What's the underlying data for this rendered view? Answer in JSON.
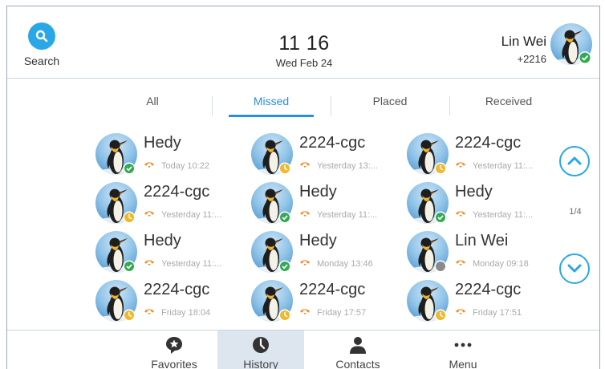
{
  "header": {
    "search_label": "Search",
    "time": "11 16",
    "date": "Wed Feb 24",
    "user_name": "Lin Wei",
    "user_ext": "+2216",
    "user_status_color": "#34a853"
  },
  "tabs": [
    {
      "label": "All",
      "active": false
    },
    {
      "label": "Missed",
      "active": true
    },
    {
      "label": "Placed",
      "active": false
    },
    {
      "label": "Received",
      "active": false
    }
  ],
  "history": [
    {
      "name": "Hedy",
      "time": "Today 10:22",
      "status": "online"
    },
    {
      "name": "2224-cgc",
      "time": "Yesterday 13:...",
      "status": "away"
    },
    {
      "name": "2224-cgc",
      "time": "Yesterday 11:...",
      "status": "away"
    },
    {
      "name": "2224-cgc",
      "time": "Yesterday 11:...",
      "status": "away"
    },
    {
      "name": "Hedy",
      "time": "Yesterday 11:...",
      "status": "online"
    },
    {
      "name": "Hedy",
      "time": "Yesterday 11:...",
      "status": "online"
    },
    {
      "name": "Hedy",
      "time": "Yesterday 11:...",
      "status": "online"
    },
    {
      "name": "Hedy",
      "time": "Monday 13:46",
      "status": "online"
    },
    {
      "name": "Lin Wei",
      "time": "Monday 09:18",
      "status": "offline"
    },
    {
      "name": "2224-cgc",
      "time": "Friday 18:04",
      "status": "away"
    },
    {
      "name": "2224-cgc",
      "time": "Friday 17:57",
      "status": "away"
    },
    {
      "name": "2224-cgc",
      "time": "Friday 17:51",
      "status": "away"
    }
  ],
  "pager": {
    "indicator": "1/4"
  },
  "nav": [
    {
      "label": "Favorites",
      "icon": "star-bubble-icon",
      "active": false
    },
    {
      "label": "History",
      "icon": "clock-icon",
      "active": true
    },
    {
      "label": "Contacts",
      "icon": "person-icon",
      "active": false
    },
    {
      "label": "Menu",
      "icon": "ellipsis-icon",
      "active": false
    }
  ],
  "colors": {
    "accent": "#2aa7e6",
    "online": "#34a853",
    "away": "#f2b82c",
    "offline": "#8a8a8a",
    "missed_call": "#f28c28"
  }
}
